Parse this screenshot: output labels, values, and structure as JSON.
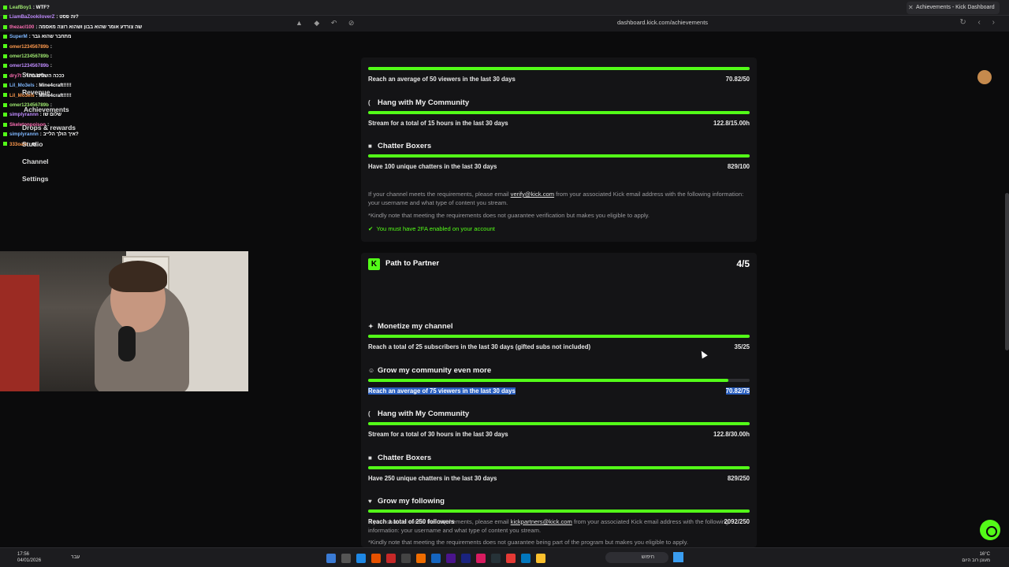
{
  "browser": {
    "tab_title": "Achievements - Kick Dashboard",
    "url": "dashboard.kick.com/achievements"
  },
  "chat_overlay": {
    "lines": [
      {
        "name": "LeafBoy1",
        "text": "WTF?"
      },
      {
        "name": "LiamBaZookiloverZ",
        "text": "זה פסט?"
      },
      {
        "name": "thezacl100",
        "text": "שה צורדע אומר שהוא בבון ושהוא רוצה מאסמה"
      },
      {
        "name": "SuperM",
        "text": "מתחבר שהוא גבר"
      },
      {
        "name": "omer123456789b",
        "text": ""
      },
      {
        "name": "omer123456789b",
        "text": ""
      },
      {
        "name": "omer123456789b",
        "text": ""
      },
      {
        "name": "dry7t",
        "text": "כככה השלים בחר"
      },
      {
        "name": "Lil_Mo3els",
        "text": "Mine4craft!!!!!"
      },
      {
        "name": "Lil_Mo3els",
        "text": "Mine4craft!!!!!"
      },
      {
        "name": "omer123456789b",
        "text": ""
      },
      {
        "name": "simplyrannn",
        "text": "שלום שו"
      },
      {
        "name": "Skeletonpoison",
        "text": ""
      },
      {
        "name": "simplyrannn",
        "text": "איך הולך הלייב?"
      },
      {
        "name": "333oam",
        "text": "ס"
      }
    ],
    "nav": [
      "Stream",
      "Revenue",
      "Achievements",
      "Drops & rewards",
      "Studio",
      "Channel",
      "Settings"
    ]
  },
  "verification": {
    "items": [
      {
        "icon": "",
        "title": "",
        "requirement": "Reach an average of 50 viewers in the last 30 days",
        "value": "70.82/50",
        "progress": 1.0
      },
      {
        "icon": "broadcast-icon",
        "title": "Hang with My Community",
        "requirement": "Stream for a total of 15 hours in the last 30 days",
        "value": "122.8/15.00h",
        "progress": 1.0
      },
      {
        "icon": "chat-icon",
        "title": "Chatter Boxers",
        "requirement": "Have 100 unique chatters in the last 30 days",
        "value": "829/100",
        "progress": 1.0
      }
    ],
    "note_prefix": "If your channel meets the requirements, please email ",
    "note_email": "verify@kick.com",
    "note_suffix": " from your associated Kick email address with the following information: your username and what type of content you stream.",
    "disclaimer": "*Kindly note that meeting the requirements does not guarantee verification but makes you eligible to apply.",
    "twofa": "You must have 2FA enabled on your account"
  },
  "partner": {
    "title": "Path to Partner",
    "count": "4/5",
    "items": [
      {
        "icon": "sparkle-icon",
        "title": "Monetize my channel",
        "requirement": "Reach a total of 25 subscribers in the last 30 days (gifted subs not included)",
        "value": "35/25",
        "progress": 1.0
      },
      {
        "icon": "community-icon",
        "title": "Grow my community even more",
        "requirement": "Reach an average of 75 viewers in the last 30 days",
        "value": "70.82/75",
        "progress": 0.944
      },
      {
        "icon": "broadcast-icon",
        "title": "Hang with My Community",
        "requirement": "Stream for a total of 30 hours in the last 30 days",
        "value": "122.8/30.00h",
        "progress": 1.0
      },
      {
        "icon": "chat-icon",
        "title": "Chatter Boxers",
        "requirement": "Have 250 unique chatters in the last 30 days",
        "value": "829/250",
        "progress": 1.0
      },
      {
        "icon": "heart-icon",
        "title": "Grow my following",
        "requirement": "Reach a total of 250 followers",
        "value": "2092/250",
        "progress": 1.0
      }
    ],
    "note_prefix": "If your channel meets the requirements, please email ",
    "note_email": "kickpartners@kick.com",
    "note_suffix": " from your associated Kick email address with the following information: your username and what type of content you stream.",
    "disclaimer": "*Kindly note that meeting the requirements does not guarantee being part of the program but makes you eligible to apply."
  },
  "taskbar": {
    "time": "17:56",
    "date": "04/01/2026",
    "lang": "עבר",
    "search": "חיפוש",
    "weather_temp": "16°C",
    "weather_text": "מעונן רוב היום"
  },
  "colors": {
    "accent": "#53fc18",
    "bar_bg": "#2f2f33",
    "highlight": "#2a5fbf"
  }
}
